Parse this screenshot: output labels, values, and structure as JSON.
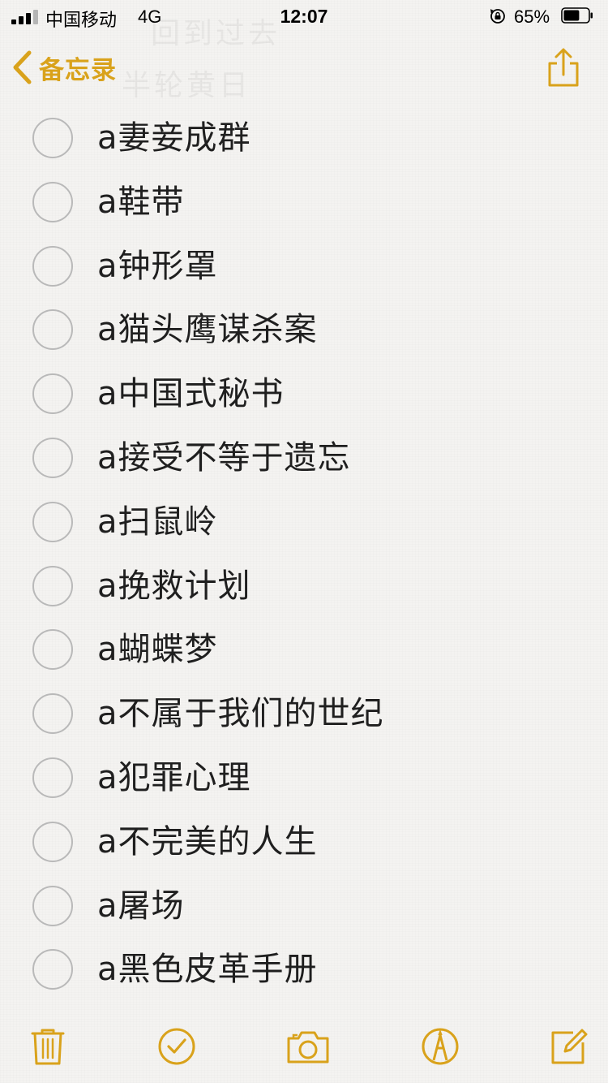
{
  "status_bar": {
    "carrier": "中国移动",
    "network": "4G",
    "time": "12:07",
    "battery_percent": "65%",
    "battery_level": 0.65
  },
  "nav": {
    "back_label": "备忘录",
    "ghost_title": "半轮黄日",
    "ghost_top": "回到过去"
  },
  "accent_color": "#d9a21b",
  "checklist": [
    {
      "label": "a妻妾成群",
      "checked": false
    },
    {
      "label": "a鞋带",
      "checked": false
    },
    {
      "label": "a钟形罩",
      "checked": false
    },
    {
      "label": "a猫头鹰谋杀案",
      "checked": false
    },
    {
      "label": "a中国式秘书",
      "checked": false
    },
    {
      "label": "a接受不等于遗忘",
      "checked": false
    },
    {
      "label": "a扫鼠岭",
      "checked": false
    },
    {
      "label": "a挽救计划",
      "checked": false
    },
    {
      "label": "a蝴蝶梦",
      "checked": false
    },
    {
      "label": "a不属于我们的世纪",
      "checked": false
    },
    {
      "label": "a犯罪心理",
      "checked": false
    },
    {
      "label": "a不完美的人生",
      "checked": false
    },
    {
      "label": "a屠场",
      "checked": false
    },
    {
      "label": "a黑色皮革手册",
      "checked": false
    }
  ],
  "toolbar": {
    "icons": [
      "trash-icon",
      "checklist-icon",
      "camera-icon",
      "markup-icon",
      "compose-icon"
    ]
  }
}
